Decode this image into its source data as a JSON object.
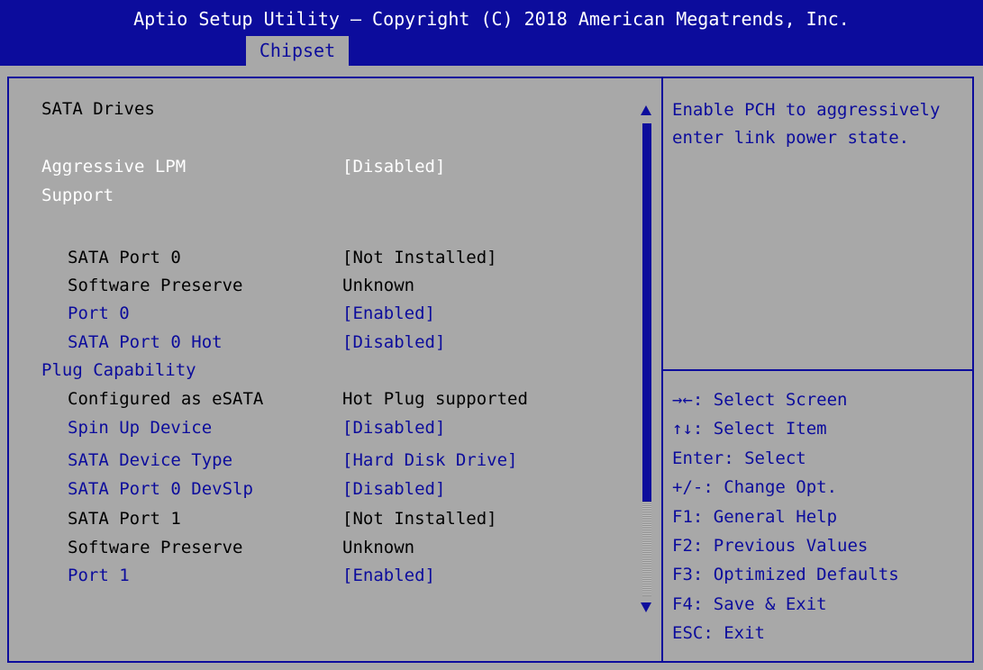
{
  "header": {
    "title": "Aptio Setup Utility – Copyright (C) 2018 American Megatrends, Inc.",
    "active_tab": "Chipset"
  },
  "colors": {
    "accent": "#0c0c9c",
    "background": "#a8a8a8",
    "highlight_text": "#ffffff"
  },
  "settings": {
    "heading": "SATA Drives",
    "aggressive_lpm": {
      "label_line1": "Aggressive LPM",
      "label_line2": "Support",
      "value": "[Disabled]"
    },
    "port0": {
      "label": "SATA Port 0",
      "value": "[Not Installed]",
      "sw_label": "Software Preserve",
      "sw_value": "Unknown",
      "port_label": "Port 0",
      "port_value": "[Enabled]",
      "hot_label_line1": "SATA Port 0 Hot",
      "hot_label_line2": "Plug Capability",
      "hot_value": "[Disabled]",
      "esata_label": "Configured as eSATA",
      "esata_value": "Hot Plug supported",
      "spin_label": "Spin Up Device",
      "spin_value": "[Disabled]",
      "type_label": "SATA Device Type",
      "type_value": "[Hard Disk Drive]",
      "devslp_label": "SATA Port 0 DevSlp",
      "devslp_value": "[Disabled]"
    },
    "port1": {
      "label": "SATA Port 1",
      "value": "[Not Installed]",
      "sw_label": "Software Preserve",
      "sw_value": "Unknown",
      "port_label": "Port 1",
      "port_value": "[Enabled]"
    }
  },
  "help_text": "Enable PCH to aggressively enter link power state.",
  "keys": [
    "→←: Select Screen",
    "↑↓: Select Item",
    "Enter: Select",
    "+/-: Change Opt.",
    "F1: General Help",
    "F2: Previous Values",
    "F3: Optimized Defaults",
    "F4: Save & Exit",
    "ESC: Exit"
  ]
}
